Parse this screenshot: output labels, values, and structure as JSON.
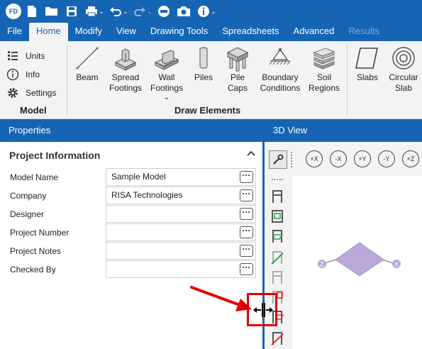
{
  "quick_access": {
    "logo_text": "FD",
    "icons": [
      "new-file-icon",
      "open-folder-icon",
      "save-icon",
      "print-icon",
      "undo-icon",
      "redo-icon",
      "minus-circle-icon",
      "camera-icon",
      "info-icon"
    ]
  },
  "tabs": [
    {
      "label": "File",
      "active": false,
      "disabled": false
    },
    {
      "label": "Home",
      "active": true,
      "disabled": false
    },
    {
      "label": "Modify",
      "active": false,
      "disabled": false
    },
    {
      "label": "View",
      "active": false,
      "disabled": false
    },
    {
      "label": "Drawing Tools",
      "active": false,
      "disabled": false
    },
    {
      "label": "Spreadsheets",
      "active": false,
      "disabled": false
    },
    {
      "label": "Advanced",
      "active": false,
      "disabled": false
    },
    {
      "label": "Results",
      "active": false,
      "disabled": true
    }
  ],
  "ribbon": {
    "model_group": {
      "label": "Model",
      "items": [
        {
          "label": "Units",
          "icon": "units-icon"
        },
        {
          "label": "Info",
          "icon": "info-circle-icon"
        },
        {
          "label": "Settings",
          "icon": "gear-icon"
        }
      ]
    },
    "draw_group": {
      "label": "Draw Elements",
      "buttons": [
        {
          "line1": "Beam",
          "line2": ""
        },
        {
          "line1": "Spread",
          "line2": "Footings"
        },
        {
          "line1": "Wall",
          "line2": "Footings"
        },
        {
          "line1": "Piles",
          "line2": ""
        },
        {
          "line1": "Pile",
          "line2": "Caps"
        },
        {
          "line1": "Boundary",
          "line2": "Conditions"
        },
        {
          "line1": "Soil",
          "line2": "Regions"
        }
      ]
    },
    "slab_group": {
      "buttons": [
        {
          "line1": "Slabs",
          "line2": ""
        },
        {
          "line1": "Circular",
          "line2": "Slab"
        }
      ]
    }
  },
  "properties": {
    "header": "Properties",
    "section_title": "Project Information",
    "rows": [
      {
        "label": "Model Name",
        "value": "Sample Model"
      },
      {
        "label": "Company",
        "value": "RISA Technologies"
      },
      {
        "label": "Designer",
        "value": ""
      },
      {
        "label": "Project Number",
        "value": ""
      },
      {
        "label": "Project Notes",
        "value": ""
      },
      {
        "label": "Checked By",
        "value": ""
      }
    ],
    "ellipsis_label": "···"
  },
  "view3d": {
    "header": "3D View",
    "rotate_buttons": [
      "+X",
      "-X",
      "+Y",
      "-Y",
      "+Z"
    ],
    "axis_labels": {
      "z": "Z",
      "x": "X"
    }
  },
  "colors": {
    "brand": "#1565b4",
    "annotation": "#e00000",
    "slab_fill": "#b9a8d8"
  }
}
